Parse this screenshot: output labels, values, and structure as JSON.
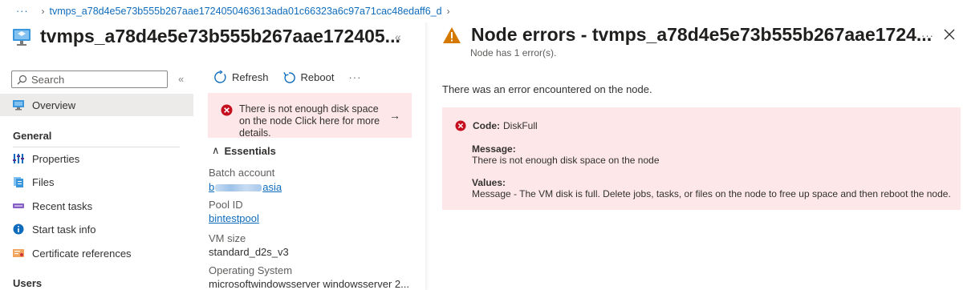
{
  "breadcrumb": {
    "more": "···",
    "node_path": "tvmps_a78d4e5e73b555b267aae1724050463613ada01c66323a6c97a71cac48edaff6_d"
  },
  "blade": {
    "title": "tvmps_a78d4e5e73b555b267aae172405...",
    "collapse": "«"
  },
  "search": {
    "placeholder": "Search"
  },
  "sidebar": {
    "collapse": "«",
    "overview": "Overview",
    "general_heading": "General",
    "items": [
      {
        "label": "Properties",
        "icon": "properties-icon"
      },
      {
        "label": "Files",
        "icon": "files-icon"
      },
      {
        "label": "Recent tasks",
        "icon": "recent-tasks-icon"
      },
      {
        "label": "Start task info",
        "icon": "info-icon"
      },
      {
        "label": "Certificate references",
        "icon": "certificate-icon"
      }
    ],
    "users_heading": "Users"
  },
  "toolbar": {
    "refresh": "Refresh",
    "reboot": "Reboot",
    "more": "···"
  },
  "banner": {
    "message": "There is not enough disk space on the node Click here for more details.",
    "arrow": "→"
  },
  "essentials": {
    "heading": "Essentials",
    "batch_account_label": "Batch account",
    "batch_account_prefix": "b",
    "batch_account_suffix": "asia",
    "pool_id_label": "Pool ID",
    "pool_id": "bintestpool",
    "vm_size_label": "VM size",
    "vm_size": "standard_d2s_v3",
    "os_label": "Operating System",
    "os": "microsoftwindowsserver windowsserver 2..."
  },
  "pane": {
    "title": "Node errors - tvmps_a78d4e5e73b555b267aae1724...",
    "subtitle": "Node has 1 error(s).",
    "more": "···",
    "intro": "There was an error encountered on the node.",
    "error": {
      "code_label": "Code:",
      "code": "DiskFull",
      "message_label": "Message:",
      "message": "There is not enough disk space on the node",
      "values_label": "Values:",
      "values": "Message - The VM disk is full. Delete jobs, tasks, or files on the node to free up space and then reboot the node."
    }
  },
  "colors": {
    "accent": "#0f6cbd",
    "error_bg": "#fde7e9",
    "error_icon": "#c50f1f",
    "warning_icon": "#d47800"
  }
}
